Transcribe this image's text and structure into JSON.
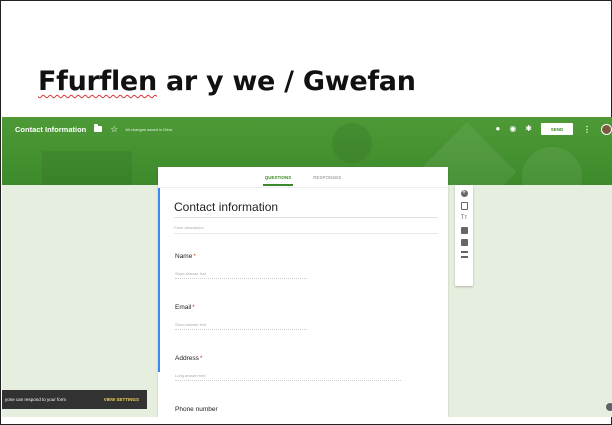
{
  "slide": {
    "title_part1": "Ffurflen",
    "title_part2": " ar y we / Gwefan"
  },
  "topbar": {
    "form_title": "Contact Information",
    "save_status": "All changes saved in Drive",
    "send_label": "SEND",
    "icons": [
      "folder-icon",
      "star-icon",
      "palette-icon",
      "eye-icon",
      "gear-icon",
      "more-vert-icon",
      "avatar"
    ]
  },
  "tabs": [
    {
      "label": "QUESTIONS",
      "active": true
    },
    {
      "label": "RESPONSES",
      "active": false
    }
  ],
  "form": {
    "title": "Contact information",
    "description_placeholder": "Form description",
    "questions": [
      {
        "label": "Name",
        "required": "*",
        "hint": "Short answer text"
      },
      {
        "label": "Email",
        "required": "*",
        "hint": "Short answer text"
      },
      {
        "label": "Address",
        "required": "*",
        "hint": "Long answer text"
      },
      {
        "label": "Phone number",
        "required": "",
        "hint": ""
      }
    ]
  },
  "side_toolbar": {
    "items": [
      {
        "icon": "add-icon",
        "glyph": "+"
      },
      {
        "icon": "import-icon",
        "glyph": ""
      },
      {
        "icon": "title-text-icon",
        "glyph": "Tт"
      },
      {
        "icon": "image-icon",
        "glyph": ""
      },
      {
        "icon": "video-icon",
        "glyph": ""
      },
      {
        "icon": "section-icon",
        "glyph": ""
      }
    ]
  },
  "snackbar": {
    "text": "yone can respond to your form",
    "action": "VIEW SETTINGS"
  },
  "colors": {
    "header": "#3d8a2b",
    "accent": "#3d8a2b",
    "background": "#e6efdf",
    "required": "#d93025",
    "snackbar": "#323232",
    "action": "#f4d35e"
  }
}
